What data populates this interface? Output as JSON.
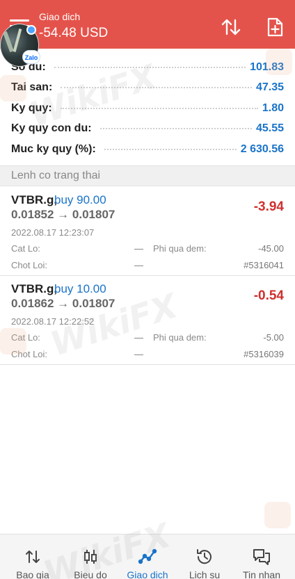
{
  "header": {
    "title": "Giao dich",
    "profit": "-54.48 USD",
    "zalo_badge": "Zalo"
  },
  "summary": [
    {
      "label": "So du:",
      "value": "101.83"
    },
    {
      "label": "Tai san:",
      "value": "47.35"
    },
    {
      "label": "Ky quy:",
      "value": "1.80"
    },
    {
      "label": "Ky quy con du:",
      "value": "45.55"
    },
    {
      "label": "Muc ky quy (%):",
      "value": "2 630.56"
    }
  ],
  "section_title": "Lenh co trang thai",
  "positions": [
    {
      "symbol": "VTBR.g,",
      "side": "buy 90.00",
      "prices": "0.01852 → 0.01807",
      "profit": "-3.94",
      "time": "2022.08.17 12:23:07",
      "sl_label": "Cat Lo:",
      "sl_value": "—",
      "swap_label": "Phi qua dem:",
      "swap_value": "-45.00",
      "tp_label": "Chot Loi:",
      "tp_value": "—",
      "ticket": "#5316041"
    },
    {
      "symbol": "VTBR.g,",
      "side": "buy 10.00",
      "prices": "0.01862 → 0.01807",
      "profit": "-0.54",
      "time": "2022.08.17 12:22:52",
      "sl_label": "Cat Lo:",
      "sl_value": "—",
      "swap_label": "Phi qua dem:",
      "swap_value": "-5.00",
      "tp_label": "Chot Loi:",
      "tp_value": "—",
      "ticket": "#5316039"
    }
  ],
  "watermark": "WikiFX",
  "nav": [
    {
      "label": "Bao gia",
      "icon": "updown-arrows-icon"
    },
    {
      "label": "Bieu do",
      "icon": "candlestick-icon"
    },
    {
      "label": "Giao dich",
      "icon": "trade-line-icon",
      "active": true
    },
    {
      "label": "Lich su",
      "icon": "history-icon"
    },
    {
      "label": "Tin nhan",
      "icon": "chat-icon"
    }
  ],
  "colors": {
    "header_bg": "#e4534b",
    "accent_blue": "#1a73c9",
    "loss_red": "#d0302e"
  }
}
